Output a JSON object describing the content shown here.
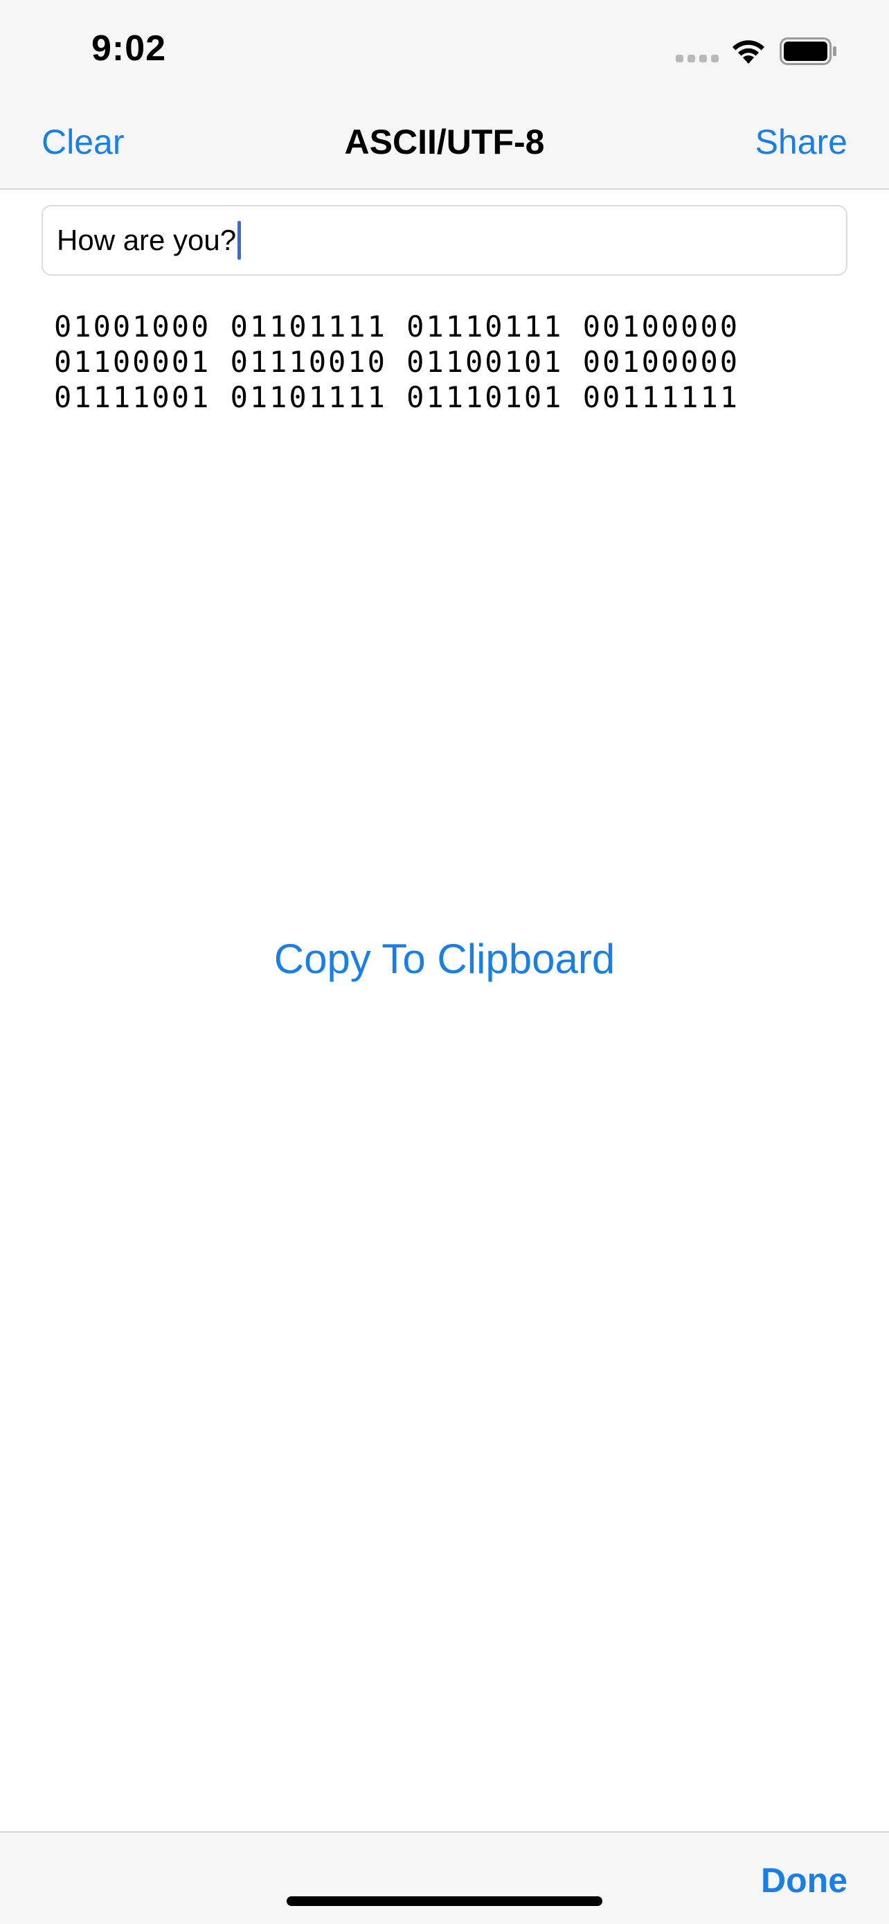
{
  "status_bar": {
    "time": "9:02",
    "icons": [
      "signal-icon",
      "wifi-icon",
      "battery-icon"
    ]
  },
  "nav_bar": {
    "left_button": "Clear",
    "title": "ASCII/UTF-8",
    "right_button": "Share"
  },
  "input": {
    "value": "How are you?"
  },
  "binary_output": {
    "lines": [
      "01001000 01101111 01110111 00100000",
      "01100001 01110010 01100101 00100000",
      "01111001 01101111 01110101 00111111"
    ]
  },
  "actions": {
    "copy_label": "Copy To Clipboard"
  },
  "toolbar": {
    "done_label": "Done"
  },
  "colors": {
    "accent": "#1a7fe3",
    "bar_background": "#f6f6f6",
    "caret": "#3e67d8"
  }
}
